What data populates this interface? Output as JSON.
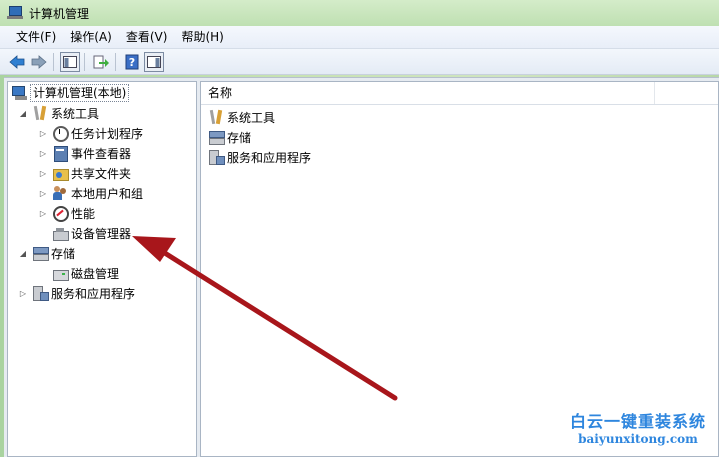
{
  "window": {
    "title": "计算机管理"
  },
  "menu": [
    "文件(F)",
    "操作(A)",
    "查看(V)",
    "帮助(H)"
  ],
  "toolbar": {
    "buttons": [
      "back-arrow-icon",
      "forward-arrow-icon",
      "show-hide-tree-icon",
      "export-list-icon",
      "help-icon",
      "show-hide-action-icon"
    ]
  },
  "tree": {
    "root": "计算机管理(本地)",
    "system_tools": "系统工具",
    "task_scheduler": "任务计划程序",
    "event_viewer": "事件查看器",
    "shared_folders": "共享文件夹",
    "local_users_groups": "本地用户和组",
    "performance": "性能",
    "device_manager": "设备管理器",
    "storage": "存储",
    "disk_management": "磁盘管理",
    "services_apps": "服务和应用程序"
  },
  "list": {
    "header_name": "名称",
    "items": [
      "系统工具",
      "存储",
      "服务和应用程序"
    ]
  },
  "watermark": {
    "line1": "白云一键重装系统",
    "line2": "baiyunxitong.com"
  },
  "colors": {
    "arrow": "#a8161b",
    "watermark": "#2e86de"
  }
}
